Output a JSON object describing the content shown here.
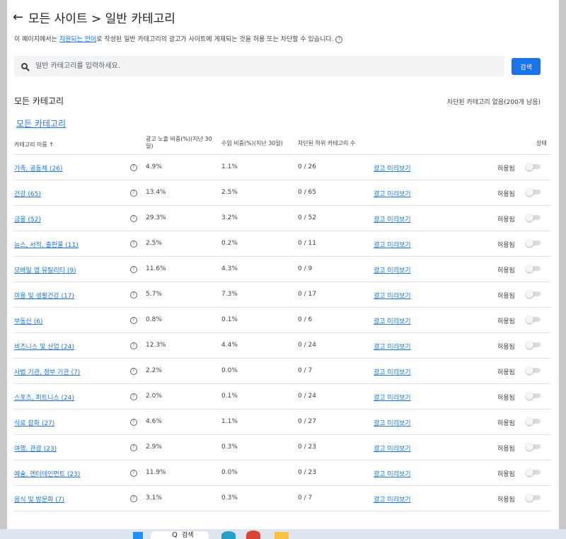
{
  "header": {
    "back_icon": "arrow-left-icon",
    "title": "모든 사이트 > 일반 카테고리"
  },
  "description": {
    "pre": "이 페이지에서는 ",
    "link": "지원되는 언어",
    "post": "로 작성된 일반 카테고리의 광고가 사이트에 게재되는 것을 허용 또는 차단할 수 있습니다."
  },
  "search": {
    "placeholder": "일반 카테고리를 입력하세요.",
    "button": "검색"
  },
  "section": {
    "title": "모든 카테고리",
    "blocked_status": "차단된 카테고리 없음(200개 남음)",
    "link": "모든 카테고리"
  },
  "table": {
    "headers": {
      "name": "카테고리 이름",
      "sort_icon": "arrow-up-icon",
      "impressions": "광고 노출 비중(%)(지난 30일)",
      "revenue": "수입 비중(%)(지난 30일)",
      "blocked": "차단된 하위 카테고리 수",
      "status": "상태"
    },
    "preview_label": "광고 미리보기",
    "status_label": "허용됨",
    "rows": [
      {
        "name": "가족, 공동체 (26)",
        "impressions": "4.9%",
        "revenue": "1.1%",
        "blocked": "0 / 26"
      },
      {
        "name": "건강 (65)",
        "impressions": "13.4%",
        "revenue": "2.5%",
        "blocked": "0 / 65"
      },
      {
        "name": "금융 (52)",
        "impressions": "29.3%",
        "revenue": "3.2%",
        "blocked": "0 / 52"
      },
      {
        "name": "뉴스, 서적, 출판물 (11)",
        "impressions": "2.5%",
        "revenue": "0.2%",
        "blocked": "0 / 11"
      },
      {
        "name": "모바일 앱 유틸리티 (9)",
        "impressions": "11.6%",
        "revenue": "4.3%",
        "blocked": "0 / 9"
      },
      {
        "name": "미용 및 생활건강 (17)",
        "impressions": "5.7%",
        "revenue": "7.3%",
        "blocked": "0 / 17"
      },
      {
        "name": "부동산 (6)",
        "impressions": "0.8%",
        "revenue": "0.1%",
        "blocked": "0 / 6"
      },
      {
        "name": "비즈니스 및 산업 (24)",
        "impressions": "12.3%",
        "revenue": "4.4%",
        "blocked": "0 / 24"
      },
      {
        "name": "사법 기관, 정부 기관 (7)",
        "impressions": "2.2%",
        "revenue": "0.0%",
        "blocked": "0 / 7"
      },
      {
        "name": "스포츠, 피트니스 (24)",
        "impressions": "2.0%",
        "revenue": "0.1%",
        "blocked": "0 / 24"
      },
      {
        "name": "식료 잡화 (27)",
        "impressions": "4.6%",
        "revenue": "1.1%",
        "blocked": "0 / 27"
      },
      {
        "name": "여행, 관광 (23)",
        "impressions": "2.9%",
        "revenue": "0.3%",
        "blocked": "0 / 23"
      },
      {
        "name": "예술, 엔터테인먼트 (23)",
        "impressions": "11.9%",
        "revenue": "0.0%",
        "blocked": "0 / 23"
      },
      {
        "name": "음식 및 방문화 (7)",
        "impressions": "3.1%",
        "revenue": "0.3%",
        "blocked": "0 / 7"
      }
    ]
  },
  "taskbar": {
    "search_label": "검색"
  }
}
